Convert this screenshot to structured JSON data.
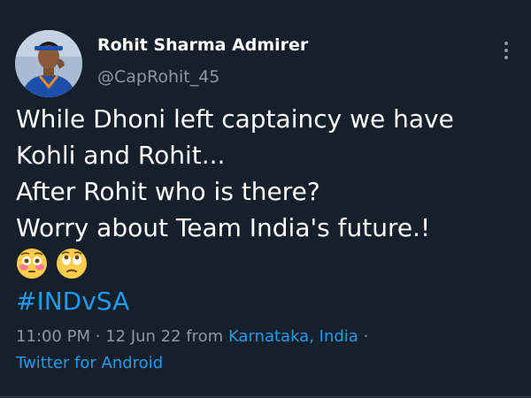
{
  "tweet": {
    "author": {
      "display_name": "Rohit Sharma Admirer",
      "handle": "@CapRohit_45"
    },
    "lines": [
      "While Dhoni left captaincy we have",
      "Kohli and Rohit...",
      "After Rohit who is there?",
      "Worry about Team India's future.!"
    ],
    "emojis": [
      "flushed-face-emoji",
      "face-with-rolling-eyes-emoji"
    ],
    "hashtag": "#INDvSA",
    "time": "11:00 PM",
    "separator": "·",
    "date": "12 Jun 22",
    "from_label": "from",
    "location": "Karnataka, India",
    "source": "Twitter for Android"
  },
  "icons": {
    "more": "more-vertical-icon"
  },
  "colors": {
    "background": "#15202b",
    "text": "#ffffff",
    "secondary": "#8b98a5",
    "accent": "#1d9bf0"
  }
}
